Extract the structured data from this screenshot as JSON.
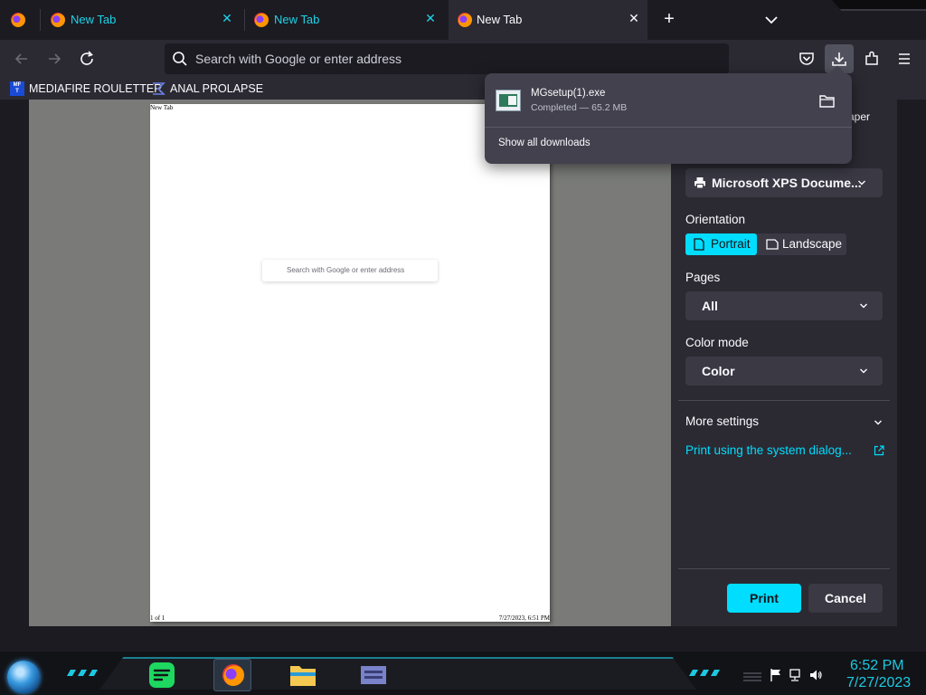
{
  "tabs": [
    {
      "label": "New Tab",
      "active": false
    },
    {
      "label": "New Tab",
      "active": false
    },
    {
      "label": "New Tab",
      "active": true
    }
  ],
  "urlbar": {
    "placeholder": "Search with Google or enter address"
  },
  "bookmarks": [
    {
      "label": "MEDIAFIRE ROULETTER",
      "icon": "mft-icon",
      "icon_text": "MF\nT"
    },
    {
      "label": "ANAL PROLAPSE",
      "icon": "sigma-icon"
    }
  ],
  "preview": {
    "header": "New Tab",
    "footer_left": "1 of 1",
    "footer_right": "7/27/2023, 6:51 PM",
    "search_placeholder": "Search with Google or enter address"
  },
  "print_panel": {
    "title_fragment": "aper",
    "destination": "Microsoft XPS Docume...",
    "orientation_label": "Orientation",
    "portrait_label": "Portrait",
    "landscape_label": "Landscape",
    "orientation_selected": "Portrait",
    "pages_label": "Pages",
    "pages_value": "All",
    "color_mode_label": "Color mode",
    "color_mode_value": "Color",
    "more_settings_label": "More settings",
    "system_dialog_label": "Print using the system dialog...",
    "print_label": "Print",
    "cancel_label": "Cancel"
  },
  "downloads": {
    "file_name": "MGsetup(1).exe",
    "status": "Completed — 65.2 MB",
    "show_all_label": "Show all downloads"
  },
  "taskbar": {
    "time": "6:52 PM",
    "date": "7/27/2023",
    "apps": [
      "spotify",
      "firefox",
      "file-explorer",
      "app"
    ]
  },
  "colors": {
    "accent": "#00ddff",
    "tab_text": "#1dd3e8",
    "clock": "#1dc9e0",
    "toolbar_bg": "#2b2a33",
    "preview_bg": "#7a7b79"
  }
}
